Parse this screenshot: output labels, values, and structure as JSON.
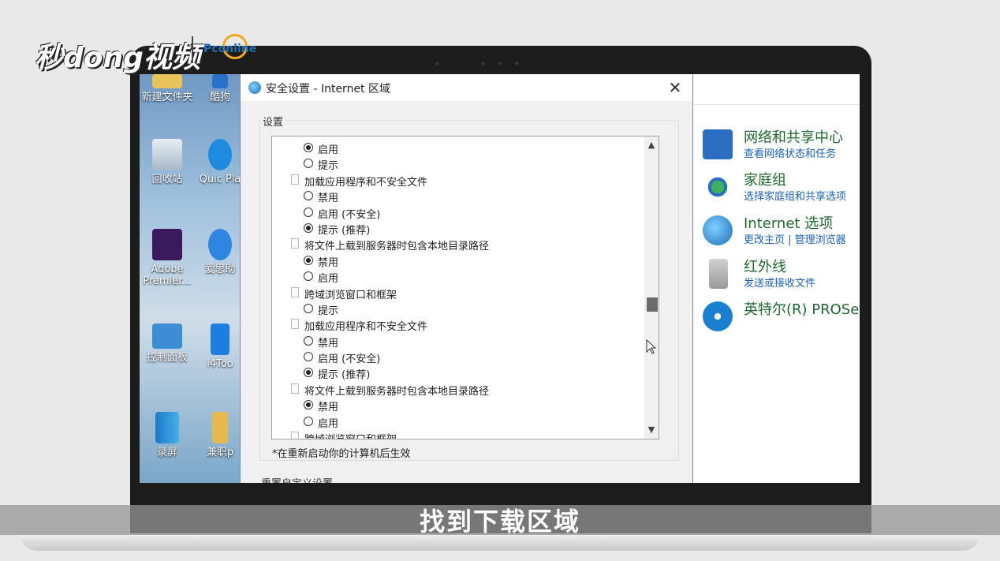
{
  "logo": {
    "main": "秒dong视频",
    "partner": "Pconline"
  },
  "desktop": {
    "icons": [
      {
        "label": "新建文件夹"
      },
      {
        "label": "酷狗"
      },
      {
        "label": "回收站"
      },
      {
        "label": "Quic Pla"
      },
      {
        "label": "Adobe Premier..."
      },
      {
        "label": "爱思助"
      },
      {
        "label": "控制面板"
      },
      {
        "label": "i4Too"
      },
      {
        "label": "录屏"
      },
      {
        "label": "兼职p"
      }
    ]
  },
  "dialog": {
    "title": "安全设置 - Internet 区域",
    "close_label": "✕",
    "group_label": "设置",
    "restart_note": "*在重新启动你的计算机后生效",
    "reset_label": "重置自定义设置",
    "items": [
      {
        "type": "option",
        "label": "启用",
        "checked": true
      },
      {
        "type": "option",
        "label": "提示",
        "checked": false
      },
      {
        "type": "heading",
        "label": "加载应用程序和不安全文件"
      },
      {
        "type": "option",
        "label": "禁用",
        "checked": false
      },
      {
        "type": "option",
        "label": "启用 (不安全)",
        "checked": false
      },
      {
        "type": "option",
        "label": "提示 (推荐)",
        "checked": true
      },
      {
        "type": "heading",
        "label": "将文件上载到服务器时包含本地目录路径"
      },
      {
        "type": "option",
        "label": "禁用",
        "checked": true
      },
      {
        "type": "option",
        "label": "启用",
        "checked": false
      },
      {
        "type": "heading",
        "label": "跨域浏览窗口和框架"
      },
      {
        "type": "option",
        "label": "提示",
        "checked": false
      },
      {
        "type": "heading",
        "label": "加载应用程序和不安全文件"
      },
      {
        "type": "option",
        "label": "禁用",
        "checked": false
      },
      {
        "type": "option",
        "label": "启用 (不安全)",
        "checked": false
      },
      {
        "type": "option",
        "label": "提示 (推荐)",
        "checked": true
      },
      {
        "type": "heading",
        "label": "将文件上载到服务器时包含本地目录路径"
      },
      {
        "type": "option",
        "label": "禁用",
        "checked": true
      },
      {
        "type": "option",
        "label": "启用",
        "checked": false
      },
      {
        "type": "heading",
        "label": "跨域浏览窗口和框架"
      }
    ]
  },
  "control_panel": {
    "items": [
      {
        "title": "网络和共享中心",
        "sub": "查看网络状态和任务",
        "color": "#2b6fc2"
      },
      {
        "title": "家庭组",
        "sub": "选择家庭组和共享选项",
        "color": "#2f9a4a"
      },
      {
        "title": "Internet 选项",
        "sub": "更改主页  |  管理浏览器",
        "color": "#3a8ad8"
      },
      {
        "title": "红外线",
        "sub": "发送或接收文件",
        "color": "#c0392b"
      },
      {
        "title": "英特尔(R) PROSet",
        "sub": "",
        "color": "#1a7fd0"
      }
    ]
  },
  "subtitle": "找到下载区域"
}
